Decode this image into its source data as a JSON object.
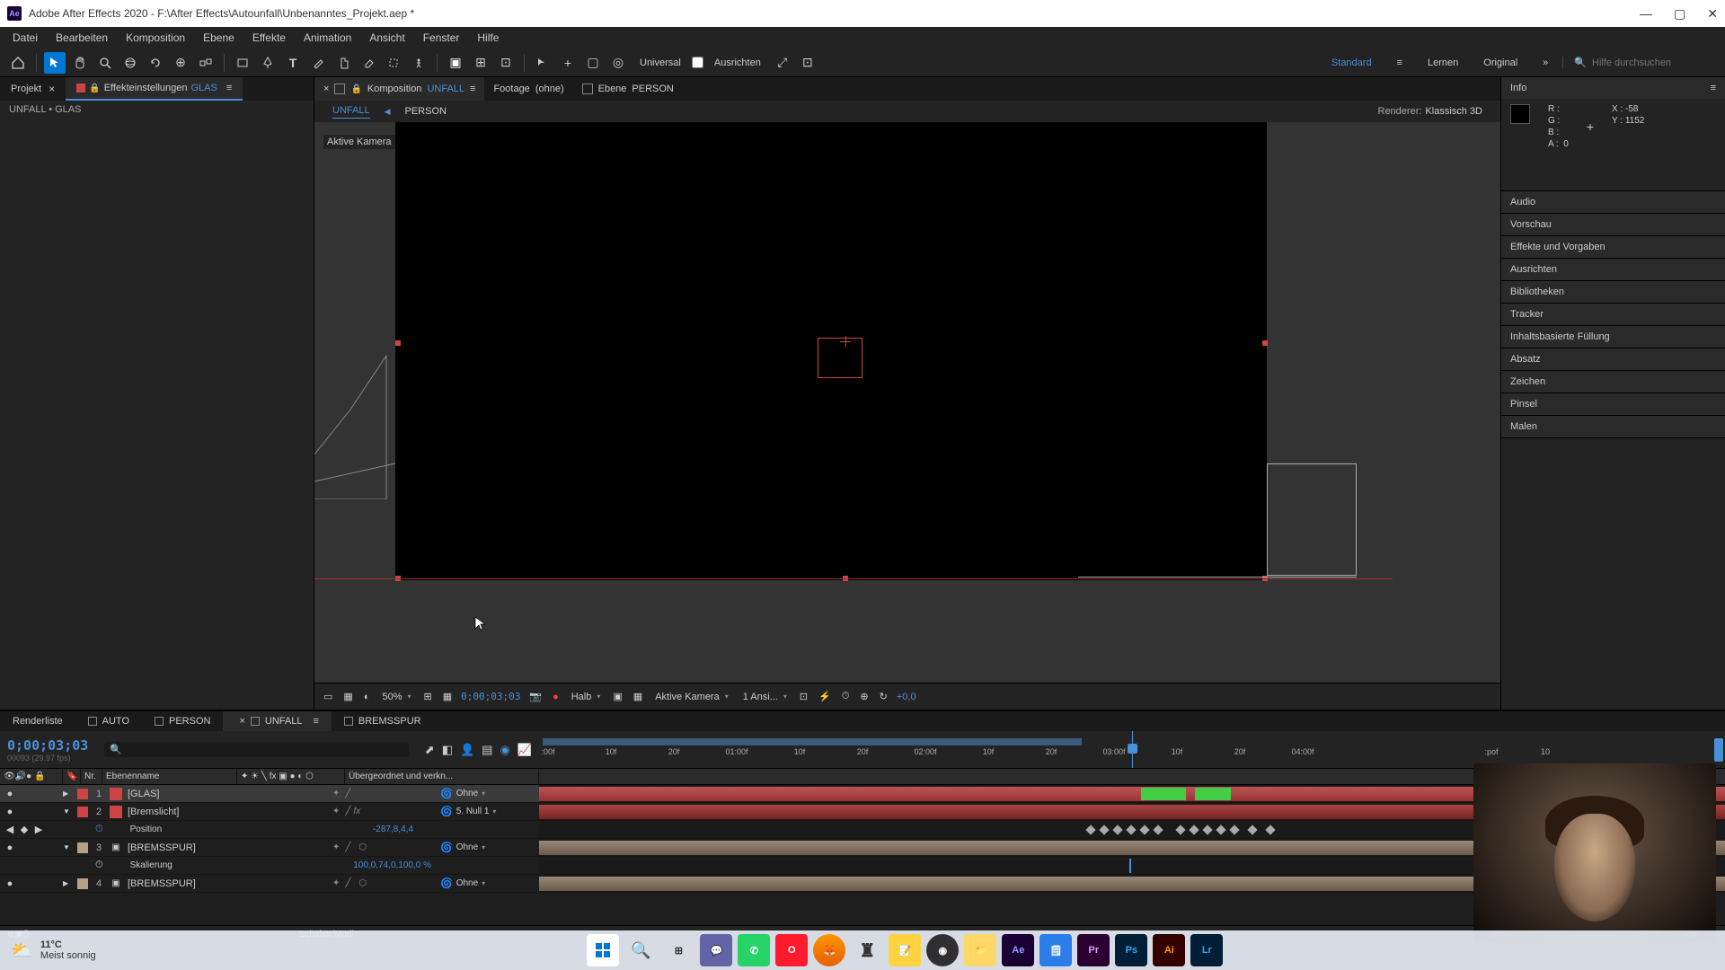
{
  "titlebar": {
    "app_initials": "Ae",
    "title": "Adobe After Effects 2020 - F:\\After Effects\\Autounfall\\Unbenanntes_Projekt.aep *"
  },
  "menu": [
    "Datei",
    "Bearbeiten",
    "Komposition",
    "Ebene",
    "Effekte",
    "Animation",
    "Ansicht",
    "Fenster",
    "Hilfe"
  ],
  "toolbar": {
    "universal": "Universal",
    "ausrichten": "Ausrichten",
    "workspaces": [
      "Standard",
      "Lernen",
      "Original"
    ],
    "search_placeholder": "Hilfe durchsuchen"
  },
  "left_panel": {
    "tab_projekt": "Projekt",
    "tab_effekt": "Effekteinstellungen",
    "tab_effekt_accent": "GLAS",
    "breadcrumb": "UNFALL • GLAS"
  },
  "comp": {
    "komp_label": "Komposition",
    "komp_name": "UNFALL",
    "footage_label": "Footage",
    "footage_name": "(ohne)",
    "ebene_label": "Ebene",
    "ebene_name": "PERSON",
    "subtab1": "UNFALL",
    "subtab2": "PERSON",
    "renderer_label": "Renderer:",
    "renderer_value": "Klassisch 3D",
    "camera_label": "Aktive Kamera"
  },
  "comp_footer": {
    "zoom": "50%",
    "time": "0;00;03;03",
    "resolution": "Halb",
    "camera": "Aktive Kamera",
    "views": "1 Ansi...",
    "exposure": "+0,0"
  },
  "info": {
    "title": "Info",
    "r": "R :",
    "g": "G :",
    "b": "B :",
    "a_label": "A :",
    "a_val": "0",
    "x_label": "X :",
    "x_val": "-58",
    "y_label": "Y :",
    "y_val": "1152"
  },
  "right_sections": [
    "Audio",
    "Vorschau",
    "Effekte und Vorgaben",
    "Ausrichten",
    "Bibliotheken",
    "Tracker",
    "Inhaltsbasierte Füllung",
    "Absatz",
    "Zeichen",
    "Pinsel",
    "Malen"
  ],
  "timeline": {
    "tab_render": "Renderliste",
    "tabs": [
      "AUTO",
      "PERSON",
      "UNFALL",
      "BREMSSPUR"
    ],
    "active_tab": "UNFALL",
    "timecode": "0;00;03;03",
    "sub_timecode": "00093 (29.97 fps)",
    "col_nr": "Nr.",
    "col_name": "Ebenenname",
    "col_parent": "Übergeordnet und verkn...",
    "ruler_ticks": [
      ":00f",
      "10f",
      "20f",
      "01:00f",
      "10f",
      "20f",
      "02:00f",
      "10f",
      "20f",
      "03:00f",
      "10f",
      "20f",
      "04:00f",
      ":pof",
      "10"
    ],
    "layers": [
      {
        "num": "1",
        "name": "[GLAS]",
        "color": "#c44",
        "parent": "Ohne",
        "selected": true,
        "icon": "solid"
      },
      {
        "num": "2",
        "name": "[Bremslicht]",
        "color": "#c44",
        "parent": "5. Null 1",
        "fx": true,
        "icon": "solid"
      },
      {
        "prop": true,
        "name": "Position",
        "val": "-287,8,4,4"
      },
      {
        "num": "3",
        "name": "[BREMSSPUR]",
        "color": "#b8a",
        "parent": "Ohne",
        "icon": "comp"
      },
      {
        "prop": true,
        "name": "Skalierung",
        "val": "100,0,74,0,100,0 %"
      },
      {
        "num": "4",
        "name": "[BREMSSPUR]",
        "color": "#b8a",
        "parent": "Ohne",
        "icon": "comp"
      }
    ],
    "footer_label": "Schalter/Modi"
  },
  "taskbar": {
    "temp": "11°C",
    "weather": "Meist sonnig"
  }
}
